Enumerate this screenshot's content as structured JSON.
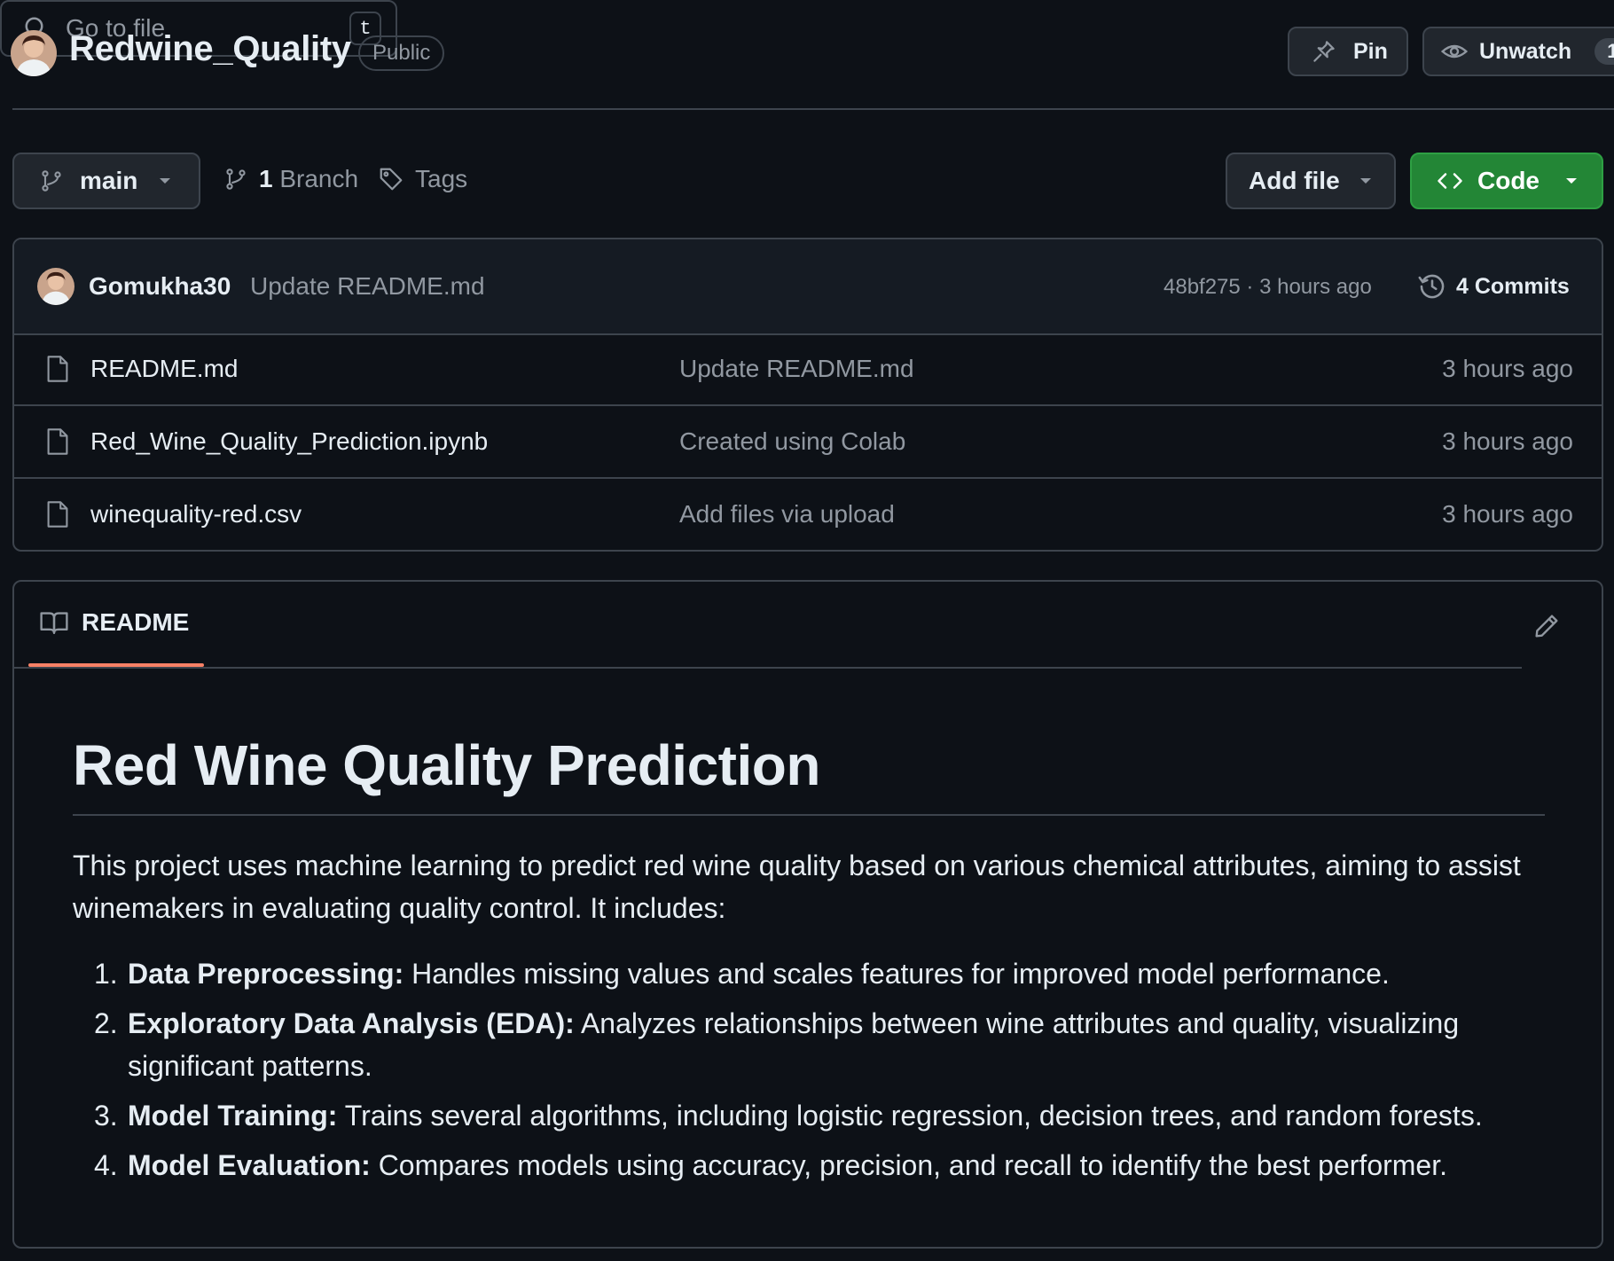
{
  "repo": {
    "name": "Redwine_Quality",
    "visibility": "Public"
  },
  "actions": {
    "pin_label": "Pin",
    "unwatch_label": "Unwatch",
    "watch_count": "1"
  },
  "toolbar": {
    "branch": "main",
    "branch_count": "1",
    "branch_word": "Branch",
    "tags_label": "Tags",
    "search_placeholder": "Go to file",
    "search_shortcut": "t",
    "add_file_label": "Add file",
    "code_label": "Code",
    "code_color": "#238636"
  },
  "latest_commit": {
    "author": "Gomukha30",
    "message": "Update README.md",
    "meta": "48bf275 · 3 hours ago",
    "commits_count_label": "4 Commits"
  },
  "files": [
    {
      "name": "README.md",
      "commit": "Update README.md",
      "time": "3 hours ago",
      "icon": "file-icon"
    },
    {
      "name": "Red_Wine_Quality_Prediction.ipynb",
      "commit": "Created using Colab",
      "time": "3 hours ago",
      "icon": "file-icon"
    },
    {
      "name": "winequality-red.csv",
      "commit": "Add files via upload",
      "time": "3 hours ago",
      "icon": "file-icon"
    }
  ],
  "readme": {
    "tab_label": "README",
    "tab_accent": "#f78166",
    "title": "Red Wine Quality Prediction",
    "intro": "This project uses machine learning to predict red wine quality based on various chemical attributes, aiming to assist winemakers in evaluating quality control. It includes:",
    "items": [
      {
        "num": "1.",
        "bold": "Data Preprocessing:",
        "text": " Handles missing values and scales features for improved model performance."
      },
      {
        "num": "2.",
        "bold": "Exploratory Data Analysis (EDA):",
        "text": " Analyzes relationships between wine attributes and quality, visualizing significant patterns."
      },
      {
        "num": "3.",
        "bold": "Model Training:",
        "text": " Trains several algorithms, including logistic regression, decision trees, and random forests."
      },
      {
        "num": "4.",
        "bold": "Model Evaluation:",
        "text": " Compares models using accuracy, precision, and recall to identify the best performer."
      }
    ]
  }
}
